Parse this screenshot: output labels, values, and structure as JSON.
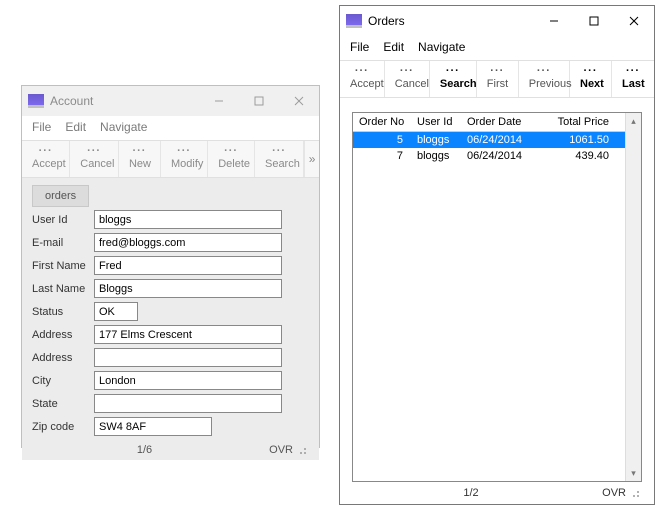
{
  "account": {
    "title": "Account",
    "menu": {
      "file": "File",
      "edit": "Edit",
      "navigate": "Navigate"
    },
    "toolbar": {
      "accept": "Accept",
      "cancel": "Cancel",
      "new": "New",
      "modify": "Modify",
      "delete": "Delete",
      "search": "Search"
    },
    "orders_btn": "orders",
    "fields": {
      "user_id": {
        "label": "User Id",
        "value": "bloggs"
      },
      "email": {
        "label": "E-mail",
        "value": "fred@bloggs.com"
      },
      "first_name": {
        "label": "First Name",
        "value": "Fred"
      },
      "last_name": {
        "label": "Last Name",
        "value": "Bloggs"
      },
      "status": {
        "label": "Status",
        "value": "OK"
      },
      "address1": {
        "label": "Address",
        "value": "177 Elms Crescent"
      },
      "address2": {
        "label": "Address",
        "value": ""
      },
      "city": {
        "label": "City",
        "value": "London"
      },
      "state": {
        "label": "State",
        "value": ""
      },
      "zip": {
        "label": "Zip code",
        "value": "SW4 8AF"
      }
    },
    "status_bar": {
      "position": "1/6",
      "mode": "OVR"
    }
  },
  "orders": {
    "title": "Orders",
    "menu": {
      "file": "File",
      "edit": "Edit",
      "navigate": "Navigate"
    },
    "toolbar": {
      "accept": "Accept",
      "cancel": "Cancel",
      "search": "Search",
      "first": "First",
      "previous": "Previous",
      "next": "Next",
      "last": "Last"
    },
    "columns": {
      "order_no": "Order No",
      "user_id": "User Id",
      "order_date": "Order Date",
      "total_price": "Total Price"
    },
    "rows": [
      {
        "order_no": "5",
        "user_id": "bloggs",
        "order_date": "06/24/2014",
        "total_price": "1061.50",
        "selected": true
      },
      {
        "order_no": "7",
        "user_id": "bloggs",
        "order_date": "06/24/2014",
        "total_price": "439.40",
        "selected": false
      }
    ],
    "status_bar": {
      "position": "1/2",
      "mode": "OVR"
    }
  }
}
